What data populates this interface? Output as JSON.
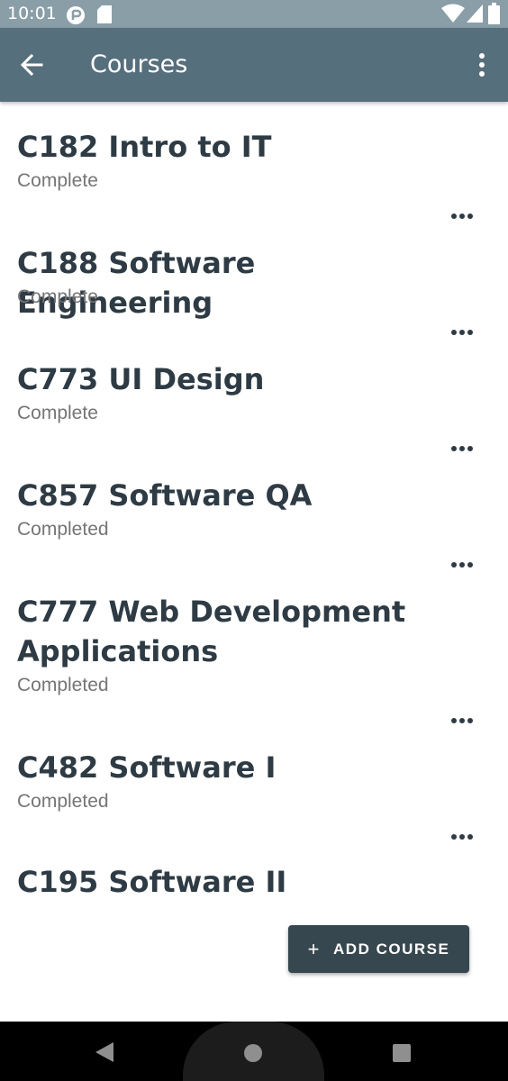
{
  "status_bar": {
    "time": "10:01",
    "icons": [
      "sync-icon",
      "sd-card-icon",
      "wifi-icon",
      "signal-icon",
      "battery-icon"
    ]
  },
  "app_bar": {
    "title": "Courses",
    "back_icon": "arrow-back-icon",
    "menu_icon": "more-vert-icon"
  },
  "courses": [
    {
      "title": "C182 Intro to IT",
      "status": "Complete"
    },
    {
      "title": "C188 Software Engineering",
      "status": "Complete"
    },
    {
      "title": "C773 UI Design",
      "status": "Complete"
    },
    {
      "title": "C857 Software QA",
      "status": "Completed"
    },
    {
      "title": "C777 Web Development Applications",
      "status": "Completed"
    },
    {
      "title": "C482 Software I",
      "status": "Completed"
    },
    {
      "title": "C195 Software II",
      "status": ""
    }
  ],
  "fab": {
    "icon": "plus",
    "label": "ADD COURSE"
  },
  "nav_bar": {
    "icons": [
      "back-triangle-icon",
      "home-circle-icon",
      "recents-square-icon"
    ]
  },
  "colors": {
    "status_bar": "#8a9ea8",
    "app_bar": "#566f7c",
    "title_text": "#2e3b44",
    "status_text": "#757575",
    "fab": "#37474f"
  }
}
